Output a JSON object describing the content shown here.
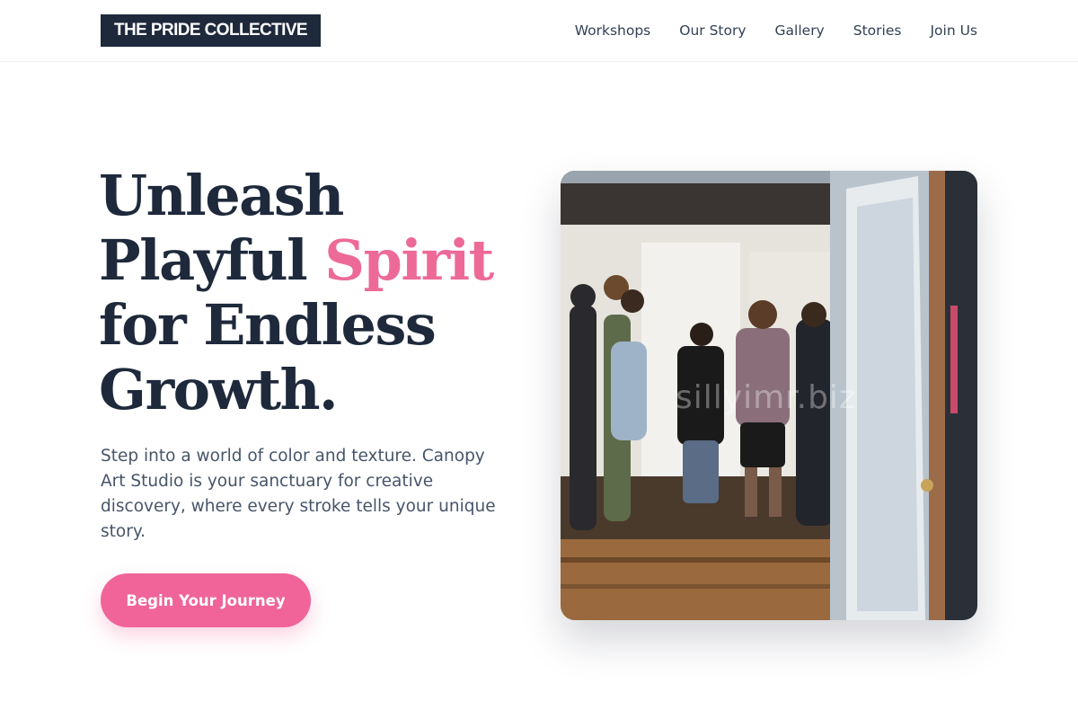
{
  "brand": {
    "name": "THE PRIDE COLLECTIVE"
  },
  "nav": {
    "links": [
      "Workshops",
      "Our Story",
      "Gallery",
      "Stories",
      "Join Us"
    ]
  },
  "hero": {
    "title_line1": "Unleash",
    "title_line2_plain": "Playful ",
    "title_line2_accent": "Spirit",
    "title_line3": "for Endless",
    "title_line4": "Growth.",
    "subtitle": "Step into a world of color and texture. Canopy Art Studio is your sanctuary for creative discovery, where every stroke tells your unique story.",
    "cta_label": "Begin Your Journey"
  },
  "photo": {
    "watermark": "sillyimr.biz"
  },
  "colors": {
    "navy": "#1e293b",
    "pink": "#f0649a",
    "text_muted": "#475569"
  }
}
